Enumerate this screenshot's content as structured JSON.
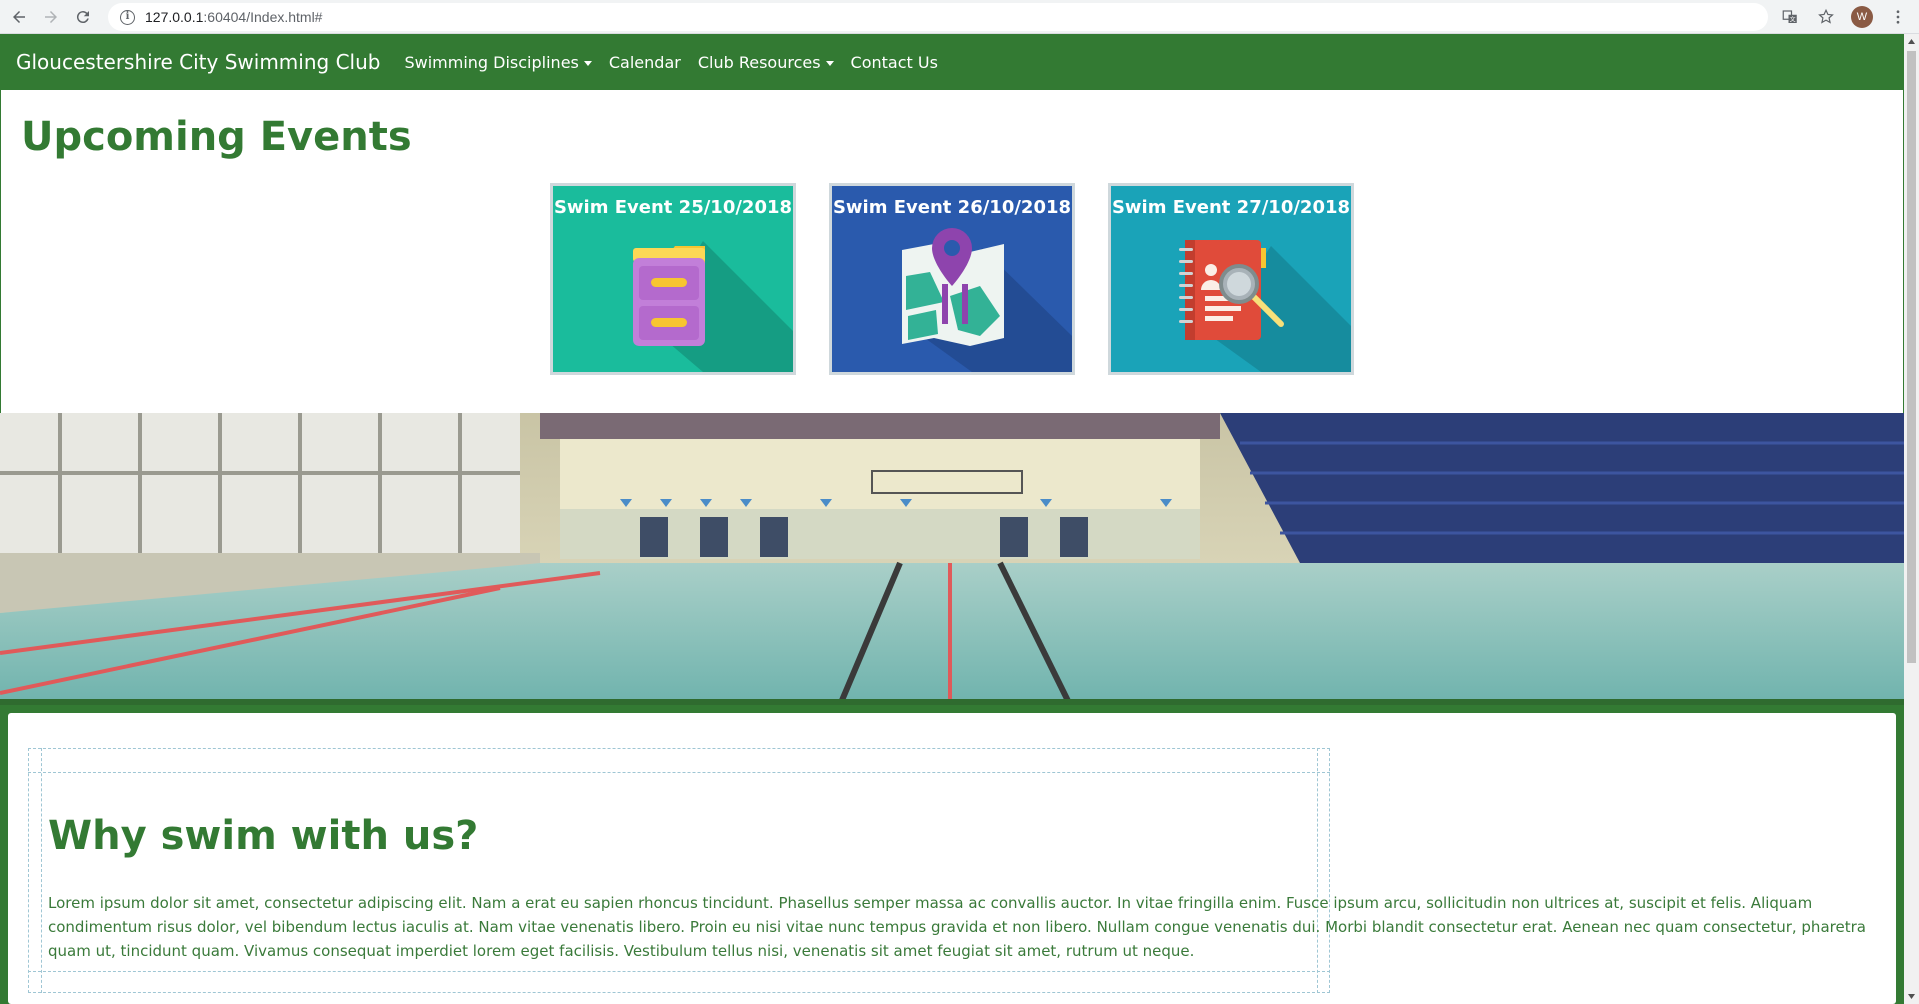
{
  "browser": {
    "url_host": "127.0.0.1",
    "url_rest": ":60404/Index.html#",
    "profile_initial": "W"
  },
  "navbar": {
    "brand": "Gloucestershire City Swimming Club",
    "links": [
      {
        "label": "Swimming Disciplines",
        "dropdown": true
      },
      {
        "label": "Calendar",
        "dropdown": false
      },
      {
        "label": "Club Resources",
        "dropdown": true
      },
      {
        "label": "Contact Us",
        "dropdown": false
      }
    ]
  },
  "events": {
    "title": "Upcoming Events",
    "cards": [
      {
        "label": "Swim Event 25/10/2018",
        "color": "#1abc9c",
        "icon": "filing-cabinet-icon"
      },
      {
        "label": "Swim Event 26/10/2018",
        "color": "#2a5aad",
        "icon": "map-pin-icon"
      },
      {
        "label": "Swim Event 27/10/2018",
        "color": "#1aa3b8",
        "icon": "notebook-search-icon"
      }
    ]
  },
  "why": {
    "title": "Why swim with us?",
    "text": "Lorem ipsum dolor sit amet, consectetur adipiscing elit. Nam a erat eu sapien rhoncus tincidunt. Phasellus semper massa ac convallis auctor. In vitae fringilla enim. Fusce ipsum arcu, sollicitudin non ultrices at, suscipit et felis. Aliquam condimentum risus dolor, vel bibendum lectus iaculis at. Nam vitae venenatis libero. Proin eu nisi vitae nunc tempus gravida et non libero. Nullam congue venenatis dui. Morbi blandit consectetur erat. Aenean nec quam consectetur, pharetra quam ut, tincidunt quam. Vivamus consequat imperdiet lorem eget facilisis. Vestibulum tellus nisi, venenatis sit amet feugiat sit amet, rutrum ut neque."
  },
  "colors": {
    "brand_green": "#337a33"
  }
}
